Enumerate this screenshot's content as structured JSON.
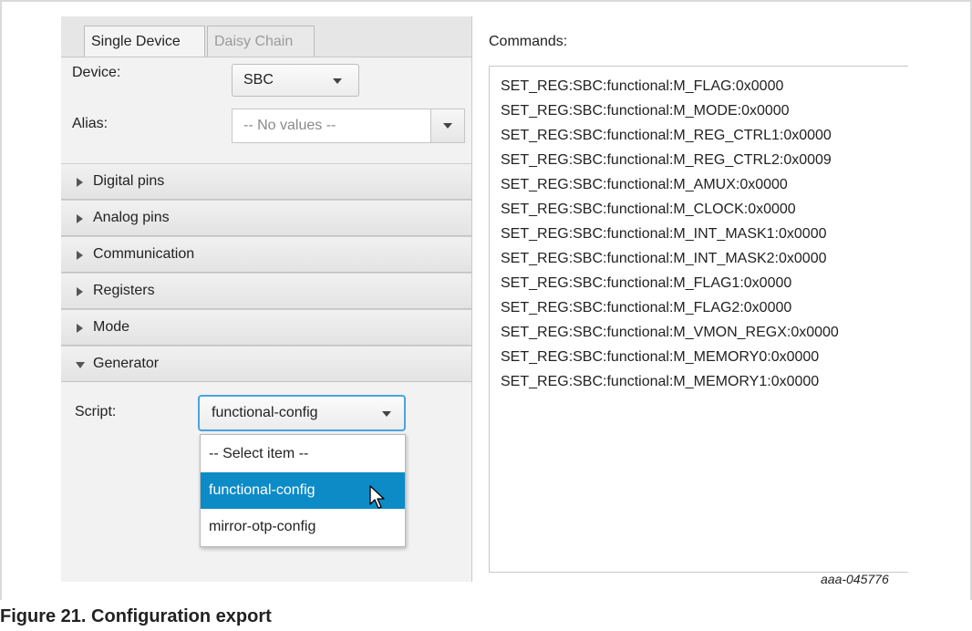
{
  "tabs": [
    {
      "label": "Single Device",
      "active": true
    },
    {
      "label": "Daisy Chain",
      "active": false
    }
  ],
  "device": {
    "label": "Device:",
    "value": "SBC"
  },
  "alias": {
    "label": "Alias:",
    "placeholder": "-- No values --"
  },
  "accordion": [
    {
      "label": "Digital pins",
      "expanded": false
    },
    {
      "label": "Analog pins",
      "expanded": false
    },
    {
      "label": "Communication",
      "expanded": false
    },
    {
      "label": "Registers",
      "expanded": false
    },
    {
      "label": "Mode",
      "expanded": false
    },
    {
      "label": "Generator",
      "expanded": true
    }
  ],
  "generator": {
    "script_label": "Script:",
    "script_value": "functional-config",
    "options": [
      "-- Select item --",
      "functional-config",
      "mirror-otp-config"
    ],
    "highlighted_option": "functional-config"
  },
  "commands": {
    "label": "Commands:",
    "lines": [
      "SET_REG:SBC:functional:M_FLAG:0x0000",
      "SET_REG:SBC:functional:M_MODE:0x0000",
      "SET_REG:SBC:functional:M_REG_CTRL1:0x0000",
      "SET_REG:SBC:functional:M_REG_CTRL2:0x0009",
      "SET_REG:SBC:functional:M_AMUX:0x0000",
      "SET_REG:SBC:functional:M_CLOCK:0x0000",
      "SET_REG:SBC:functional:M_INT_MASK1:0x0000",
      "SET_REG:SBC:functional:M_INT_MASK2:0x0000",
      "SET_REG:SBC:functional:M_FLAG1:0x0000",
      "SET_REG:SBC:functional:M_FLAG2:0x0000",
      "SET_REG:SBC:functional:M_VMON_REGX:0x0000",
      "SET_REG:SBC:functional:M_MEMORY0:0x0000",
      "SET_REG:SBC:functional:M_MEMORY1:0x0000"
    ]
  },
  "figure_id": "aaa-045776",
  "caption": "Figure 21.  Configuration export",
  "colors": {
    "accent": "#0d8bc7",
    "focus_border": "#4aa3df"
  }
}
